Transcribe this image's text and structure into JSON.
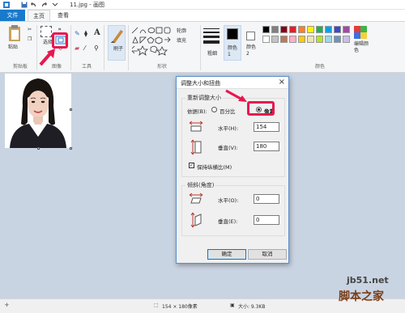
{
  "window": {
    "title": "11.jpg - 画图"
  },
  "tabs": {
    "file": "文件",
    "home": "主页",
    "view": "查看"
  },
  "ribbon": {
    "clipboard": {
      "paste": "粘贴",
      "group": "剪贴板"
    },
    "image": {
      "select": "选择",
      "group": "图像"
    },
    "tools": {
      "group": "工具",
      "letter": "A"
    },
    "brushes": {
      "label": "刷子"
    },
    "shapes": {
      "outline": "轮廓",
      "fill": "填充",
      "group": "形状"
    },
    "size": {
      "label": "粗细"
    },
    "colors": {
      "color1": "颜色 1",
      "color2": "颜色 2",
      "edit": "编辑颜色",
      "group": "颜色",
      "palette_row1": [
        "#000000",
        "#7f7f7f",
        "#880015",
        "#ed1c24",
        "#ff7f27",
        "#fff200",
        "#22b14c",
        "#00a2e8",
        "#3f48cc",
        "#a349a4"
      ],
      "palette_row2": [
        "#ffffff",
        "#c3c3c3",
        "#b97a57",
        "#ffaec9",
        "#ffc90e",
        "#efe4b0",
        "#b5e61d",
        "#99d9ea",
        "#7092be",
        "#c8bfe7"
      ]
    }
  },
  "dialog": {
    "title": "调整大小和扭曲",
    "resize_group": "重新调整大小",
    "by_label": "依据(B):",
    "percent": "百分比",
    "pixels": "像素",
    "horizontal": "水平(H):",
    "vertical": "垂直(V):",
    "h_value": "154",
    "v_value": "180",
    "keep_ratio": "保持纵横比(M)",
    "skew_group": "倾斜(角度)",
    "skew_h": "水平(O):",
    "skew_v": "垂直(E):",
    "skew_h_value": "0",
    "skew_v_value": "0",
    "ok": "确定",
    "cancel": "取消"
  },
  "status": {
    "dimensions": "154 × 180像素",
    "size": "大小: 9.3KB"
  },
  "watermark": {
    "site": "jb51.net",
    "brand": "脚本之家"
  },
  "accent": "#e8174f"
}
